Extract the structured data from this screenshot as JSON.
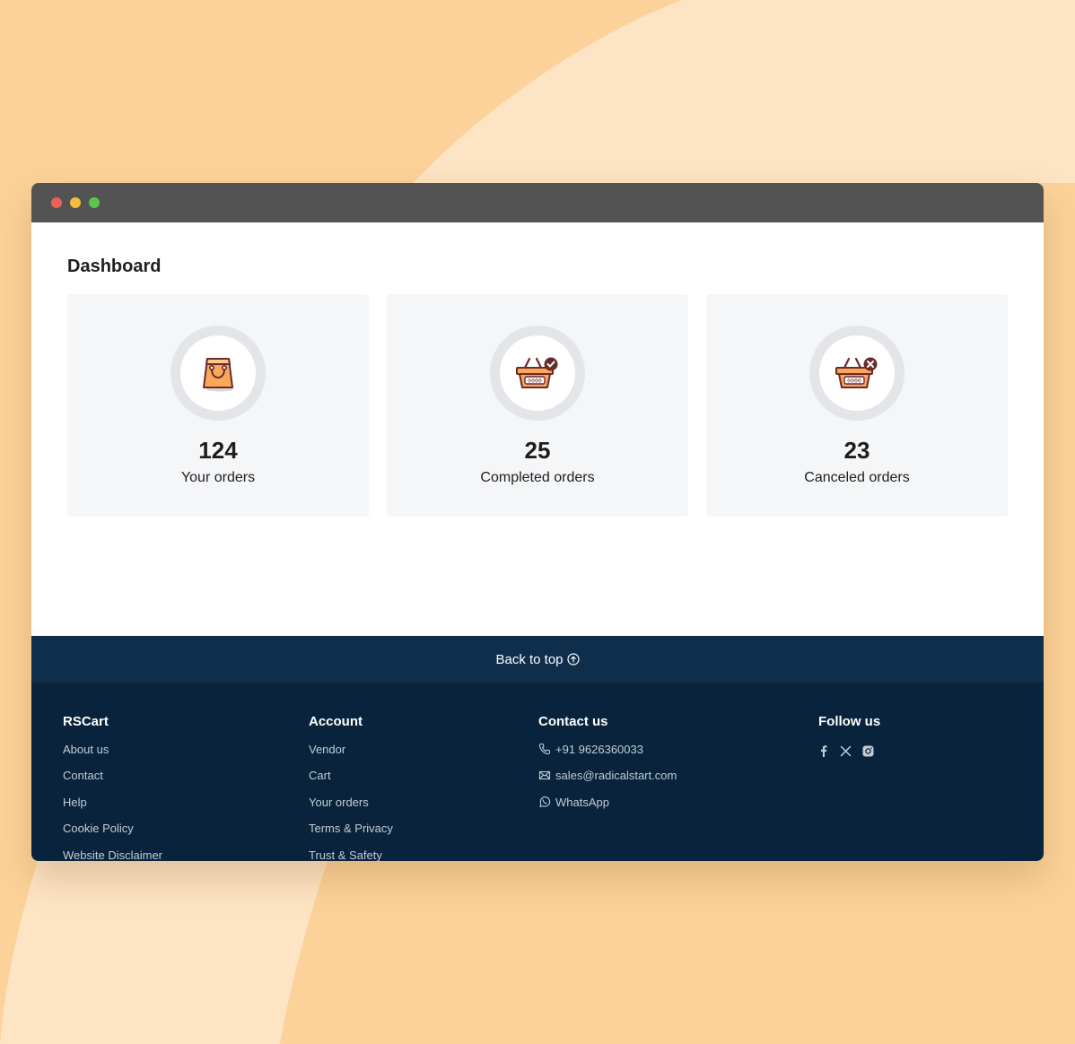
{
  "page": {
    "title": "Dashboard"
  },
  "cards": [
    {
      "value": "124",
      "label": "Your orders",
      "icon": "shopping-bag-icon"
    },
    {
      "value": "25",
      "label": "Completed orders",
      "icon": "basket-check-icon"
    },
    {
      "value": "23",
      "label": "Canceled orders",
      "icon": "basket-cancel-icon"
    }
  ],
  "back_to_top": {
    "label": "Back to top",
    "icon": "arrow-up-circle-icon"
  },
  "footer": {
    "brand": {
      "title": "RSCart",
      "links": [
        "About us",
        "Contact",
        "Help",
        "Cookie Policy",
        "Website Disclaimer"
      ]
    },
    "account": {
      "title": "Account",
      "links": [
        "Vendor",
        "Cart",
        "Your orders",
        "Terms & Privacy",
        "Trust & Safety"
      ]
    },
    "contact": {
      "title": "Contact us",
      "phone": "+91 9626360033",
      "email": "sales@radicalstart.com",
      "whatsapp": "WhatsApp"
    },
    "follow": {
      "title": "Follow us",
      "icons": [
        "facebook-icon",
        "x-icon",
        "instagram-icon"
      ]
    }
  },
  "colors": {
    "background": "#fcd29a",
    "titlebar": "#535353",
    "back_to_top_bar": "#0e2e4b",
    "footer": "#08233b",
    "card": "#f5f6f8"
  }
}
